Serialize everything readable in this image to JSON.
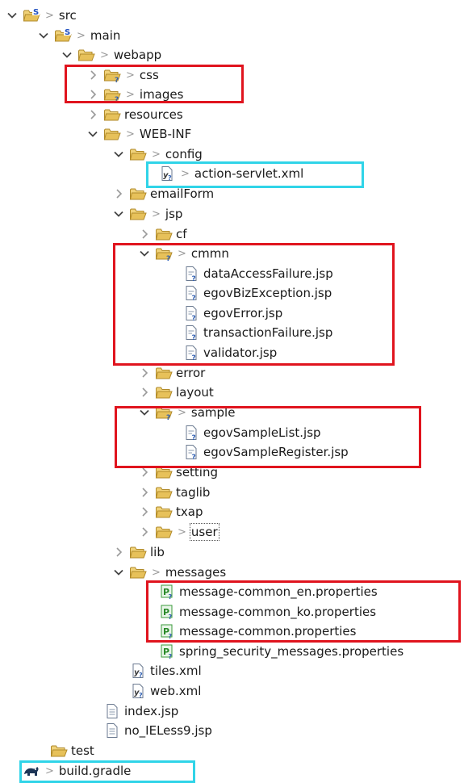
{
  "colors": {
    "highlight_red": "#e0141e",
    "highlight_cyan": "#30d4e8",
    "folder": "#e7c15a",
    "text": "#1a1a1a"
  },
  "tree": [
    {
      "label": "src",
      "toggle": "expanded",
      "icon": "source-folder-icon",
      "gt": true
    },
    {
      "label": "main",
      "toggle": "expanded",
      "icon": "source-folder-icon",
      "gt": true
    },
    {
      "label": "webapp",
      "toggle": "expanded",
      "icon": "folder-icon",
      "gt": true
    },
    {
      "label": "css",
      "toggle": "collapsed",
      "icon": "folder-unknown-icon",
      "gt": true
    },
    {
      "label": "images",
      "toggle": "collapsed",
      "icon": "folder-unknown-icon",
      "gt": true
    },
    {
      "label": "resources",
      "toggle": "collapsed",
      "icon": "folder-icon",
      "gt": false
    },
    {
      "label": "WEB-INF",
      "toggle": "expanded",
      "icon": "folder-icon",
      "gt": true
    },
    {
      "label": "config",
      "toggle": "expanded",
      "icon": "folder-icon",
      "gt": true
    },
    {
      "label": "action-servlet.xml",
      "toggle": "none",
      "icon": "xml-file-icon",
      "gt": true
    },
    {
      "label": "emailForm",
      "toggle": "collapsed",
      "icon": "folder-icon",
      "gt": false
    },
    {
      "label": "jsp",
      "toggle": "expanded",
      "icon": "folder-icon",
      "gt": true
    },
    {
      "label": "cf",
      "toggle": "collapsed",
      "icon": "folder-icon",
      "gt": false
    },
    {
      "label": "cmmn",
      "toggle": "expanded",
      "icon": "folder-unknown-icon",
      "gt": true
    },
    {
      "label": "dataAccessFailure.jsp",
      "toggle": "none",
      "icon": "jsp-file-icon",
      "gt": false
    },
    {
      "label": "egovBizException.jsp",
      "toggle": "none",
      "icon": "jsp-file-icon",
      "gt": false
    },
    {
      "label": "egovError.jsp",
      "toggle": "none",
      "icon": "jsp-file-icon",
      "gt": false
    },
    {
      "label": "transactionFailure.jsp",
      "toggle": "none",
      "icon": "jsp-file-icon",
      "gt": false
    },
    {
      "label": "validator.jsp",
      "toggle": "none",
      "icon": "jsp-file-icon",
      "gt": false
    },
    {
      "label": "error",
      "toggle": "collapsed",
      "icon": "folder-icon",
      "gt": false
    },
    {
      "label": "layout",
      "toggle": "collapsed",
      "icon": "folder-icon",
      "gt": false
    },
    {
      "label": "sample",
      "toggle": "expanded",
      "icon": "folder-unknown-icon",
      "gt": true
    },
    {
      "label": "egovSampleList.jsp",
      "toggle": "none",
      "icon": "jsp-file-icon",
      "gt": false
    },
    {
      "label": "egovSampleRegister.jsp",
      "toggle": "none",
      "icon": "jsp-file-icon",
      "gt": false
    },
    {
      "label": "setting",
      "toggle": "collapsed",
      "icon": "folder-icon",
      "gt": false
    },
    {
      "label": "taglib",
      "toggle": "collapsed",
      "icon": "folder-icon",
      "gt": false
    },
    {
      "label": "txap",
      "toggle": "collapsed",
      "icon": "folder-icon",
      "gt": false
    },
    {
      "label": "user",
      "toggle": "collapsed",
      "icon": "folder-icon",
      "gt": true
    },
    {
      "label": "lib",
      "toggle": "collapsed",
      "icon": "folder-icon",
      "gt": false
    },
    {
      "label": "messages",
      "toggle": "expanded",
      "icon": "folder-icon",
      "gt": true
    },
    {
      "label": "message-common_en.properties",
      "toggle": "none",
      "icon": "properties-file-icon",
      "gt": false
    },
    {
      "label": "message-common_ko.properties",
      "toggle": "none",
      "icon": "properties-file-icon",
      "gt": false
    },
    {
      "label": "message-common.properties",
      "toggle": "none",
      "icon": "properties-file-icon",
      "gt": false
    },
    {
      "label": "spring_security_messages.properties",
      "toggle": "none",
      "icon": "properties-file-icon",
      "gt": false
    },
    {
      "label": "tiles.xml",
      "toggle": "none",
      "icon": "xml-file-icon",
      "gt": false
    },
    {
      "label": "web.xml",
      "toggle": "none",
      "icon": "xml-file-icon",
      "gt": false
    },
    {
      "label": "index.jsp",
      "toggle": "none",
      "icon": "text-file-icon",
      "gt": false
    },
    {
      "label": "no_IELess9.jsp",
      "toggle": "none",
      "icon": "text-file-icon",
      "gt": false
    },
    {
      "label": "test",
      "toggle": "none",
      "icon": "folder-icon",
      "gt": false
    },
    {
      "label": "build.gradle",
      "toggle": "none",
      "icon": "gradle-file-icon",
      "gt": true
    }
  ]
}
